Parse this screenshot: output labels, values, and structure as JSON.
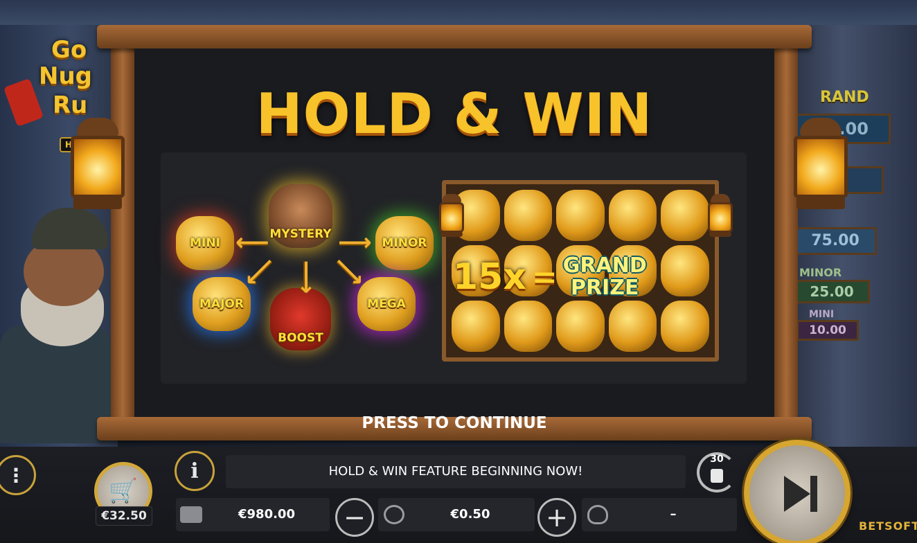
{
  "game": {
    "logo_line1": "Go",
    "logo_line2": "Nug",
    "logo_line3": "Ru",
    "logo_tag": "HO"
  },
  "jackpots": {
    "grand_label": "RAND",
    "grand_value": "00.00",
    "minor_row_value": "75.00",
    "minor_label": "MINOR",
    "minor_value": "25.00",
    "mini_label": "MINI",
    "mini_value": "10.00"
  },
  "feature_panel": {
    "title": "HOLD & WIN",
    "symbols": {
      "mini": "MINI",
      "mystery": "MYSTERY",
      "minor": "MINOR",
      "major": "MAJOR",
      "mega": "MEGA",
      "boost": "BOOST"
    },
    "grand_multiplier": "15x",
    "grand_equals": "=",
    "grand_line1": "GRAND",
    "grand_line2": "PRIZE",
    "continue_label": "PRESS TO CONTINUE"
  },
  "controls": {
    "menu_icon": "⋮",
    "info_icon": "i",
    "shop_icon": "🛒",
    "shop_price": "€32.50",
    "message": "HOLD & WIN FEATURE BEGINNING NOW!",
    "balance": "€980.00",
    "minus_icon": "−",
    "bet": "€0.50",
    "plus_icon": "+",
    "win": "–",
    "autoplay_count": "30",
    "brand": "BETSOFT"
  }
}
